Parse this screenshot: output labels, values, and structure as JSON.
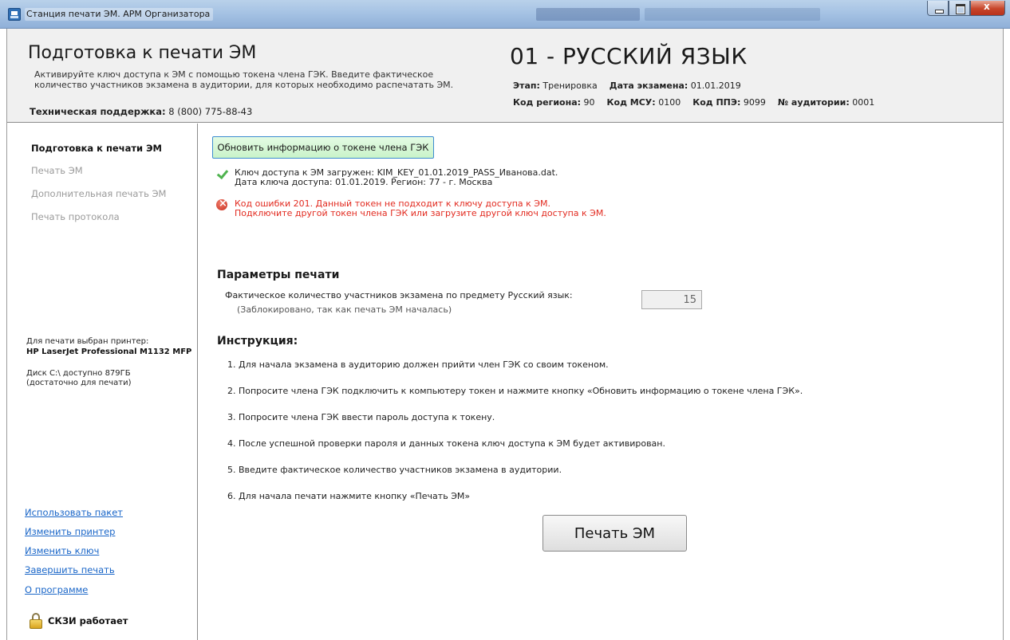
{
  "window": {
    "title": "Станция печати ЭМ. АРМ Организатора"
  },
  "header": {
    "title": "Подготовка к печати ЭМ",
    "subtitle": "Активируйте ключ доступа к ЭМ с помощью токена члена ГЭК. Введите фактическое количество участников экзамена в аудитории, для которых необходимо распечатать ЭМ.",
    "support_label": "Техническая поддержка:",
    "support_phone": "8 (800) 775-88-43",
    "subject": "01 - РУССКИЙ ЯЗЫК",
    "stage_label": "Этап:",
    "stage_value": "Тренировка",
    "exam_date_label": "Дата экзамена:",
    "exam_date_value": "01.01.2019",
    "region_label": "Код региона:",
    "region_value": "90",
    "msu_label": "Код МСУ:",
    "msu_value": "0100",
    "ppe_label": "Код ППЭ:",
    "ppe_value": "9099",
    "room_label": "№ аудитории:",
    "room_value": "0001"
  },
  "sidebar": {
    "nav": [
      {
        "label": "Подготовка к печати ЭМ",
        "active": true
      },
      {
        "label": "Печать ЭМ",
        "active": false
      },
      {
        "label": "Дополнительная печать ЭМ",
        "active": false
      },
      {
        "label": "Печать протокола",
        "active": false
      }
    ],
    "printer_label": "Для печати выбран принтер:",
    "printer_name": "HP LaserJet Professional M1132 MFP",
    "disk_info_line1": "Диск C:\\ доступно 879ГБ",
    "disk_info_line2": "(достаточно для печати)",
    "links": [
      {
        "label": "Использовать пакет"
      },
      {
        "label": "Изменить принтер"
      },
      {
        "label": "Изменить ключ"
      },
      {
        "label": "Завершить печать"
      },
      {
        "label": "О программе"
      }
    ],
    "skzi_status": "СКЗИ работает"
  },
  "content": {
    "refresh_button": "Обновить информацию о токене члена ГЭК",
    "key_loaded_line1": "Ключ доступа к ЭМ загружен: KIM_KEY_01.01.2019_PASS_Иванова.dat.",
    "key_loaded_line2": "Дата ключа доступа: 01.01.2019. Регион: 77 - г. Москва",
    "error_line1": "Код ошибки 201. Данный токен не подходит к ключу доступа к ЭМ.",
    "error_line2": "Подключите другой токен члена ГЭК или загрузите другой ключ доступа к ЭМ.",
    "print_params_title": "Параметры печати",
    "participants_label": "Фактическое количество участников экзамена по предмету Русский язык:",
    "participants_note": "(Заблокировано, так как печать ЭМ началась)",
    "participants_value": "15",
    "instructions_title": "Инструкция:",
    "instructions": [
      "1. Для начала экзамена в аудиторию должен прийти член ГЭК со своим токеном.",
      "2. Попросите члена ГЭК подключить к компьютеру токен и нажмите кнопку «Обновить информацию о токене члена ГЭК».",
      "3. Попросите члена ГЭК ввести пароль доступа к токену.",
      "4. После успешной проверки пароля и данных токена ключ доступа к ЭМ будет активирован.",
      "5. Введите фактическое количество участников экзамена в аудитории.",
      "6. Для начала печати нажмите кнопку «Печать ЭМ»"
    ],
    "print_button": "Печать ЭМ"
  },
  "colors": {
    "error_text": "#e22a1f",
    "link": "#1a66c8",
    "success": "#4fb34f",
    "refresh_button_bg": "#d4f7d4"
  }
}
